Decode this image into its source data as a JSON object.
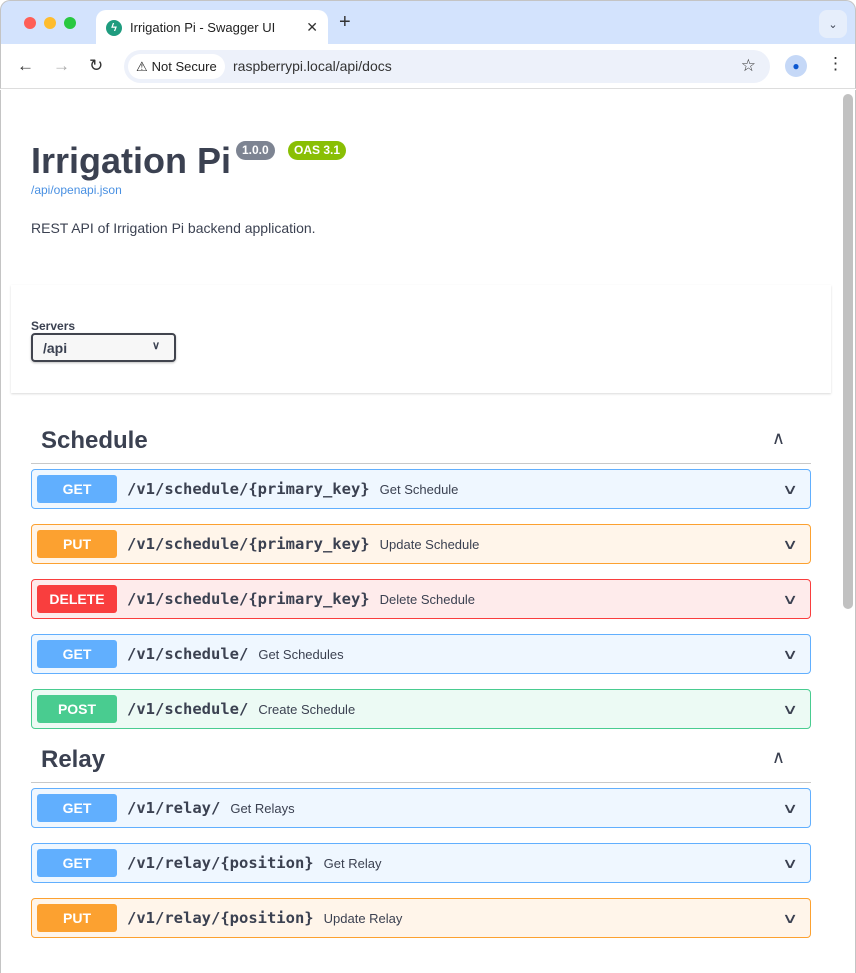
{
  "browser": {
    "tab_title": "Irrigation Pi - Swagger UI",
    "security_label": "Not Secure",
    "url": "raspberrypi.local/api/docs"
  },
  "info": {
    "title": "Irrigation Pi",
    "version": "1.0.0",
    "oas": "OAS 3.1",
    "spec_link": "/api/openapi.json",
    "description": "REST API of Irrigation Pi backend application."
  },
  "servers": {
    "label": "Servers",
    "selected": "/api"
  },
  "colors": {
    "GET": "#61affe",
    "PUT": "#fca130",
    "DELETE": "#f93e3e",
    "POST": "#49cc90",
    "version_badge": "#7d8492",
    "oas_badge": "#89bf04"
  },
  "tags": [
    {
      "name": "Schedule",
      "operations": [
        {
          "method": "GET",
          "path": "/v1/schedule/{primary_key}",
          "summary": "Get Schedule"
        },
        {
          "method": "PUT",
          "path": "/v1/schedule/{primary_key}",
          "summary": "Update Schedule"
        },
        {
          "method": "DELETE",
          "path": "/v1/schedule/{primary_key}",
          "summary": "Delete Schedule"
        },
        {
          "method": "GET",
          "path": "/v1/schedule/",
          "summary": "Get Schedules"
        },
        {
          "method": "POST",
          "path": "/v1/schedule/",
          "summary": "Create Schedule"
        }
      ]
    },
    {
      "name": "Relay",
      "operations": [
        {
          "method": "GET",
          "path": "/v1/relay/",
          "summary": "Get Relays"
        },
        {
          "method": "GET",
          "path": "/v1/relay/{position}",
          "summary": "Get Relay"
        },
        {
          "method": "PUT",
          "path": "/v1/relay/{position}",
          "summary": "Update Relay"
        }
      ]
    }
  ]
}
